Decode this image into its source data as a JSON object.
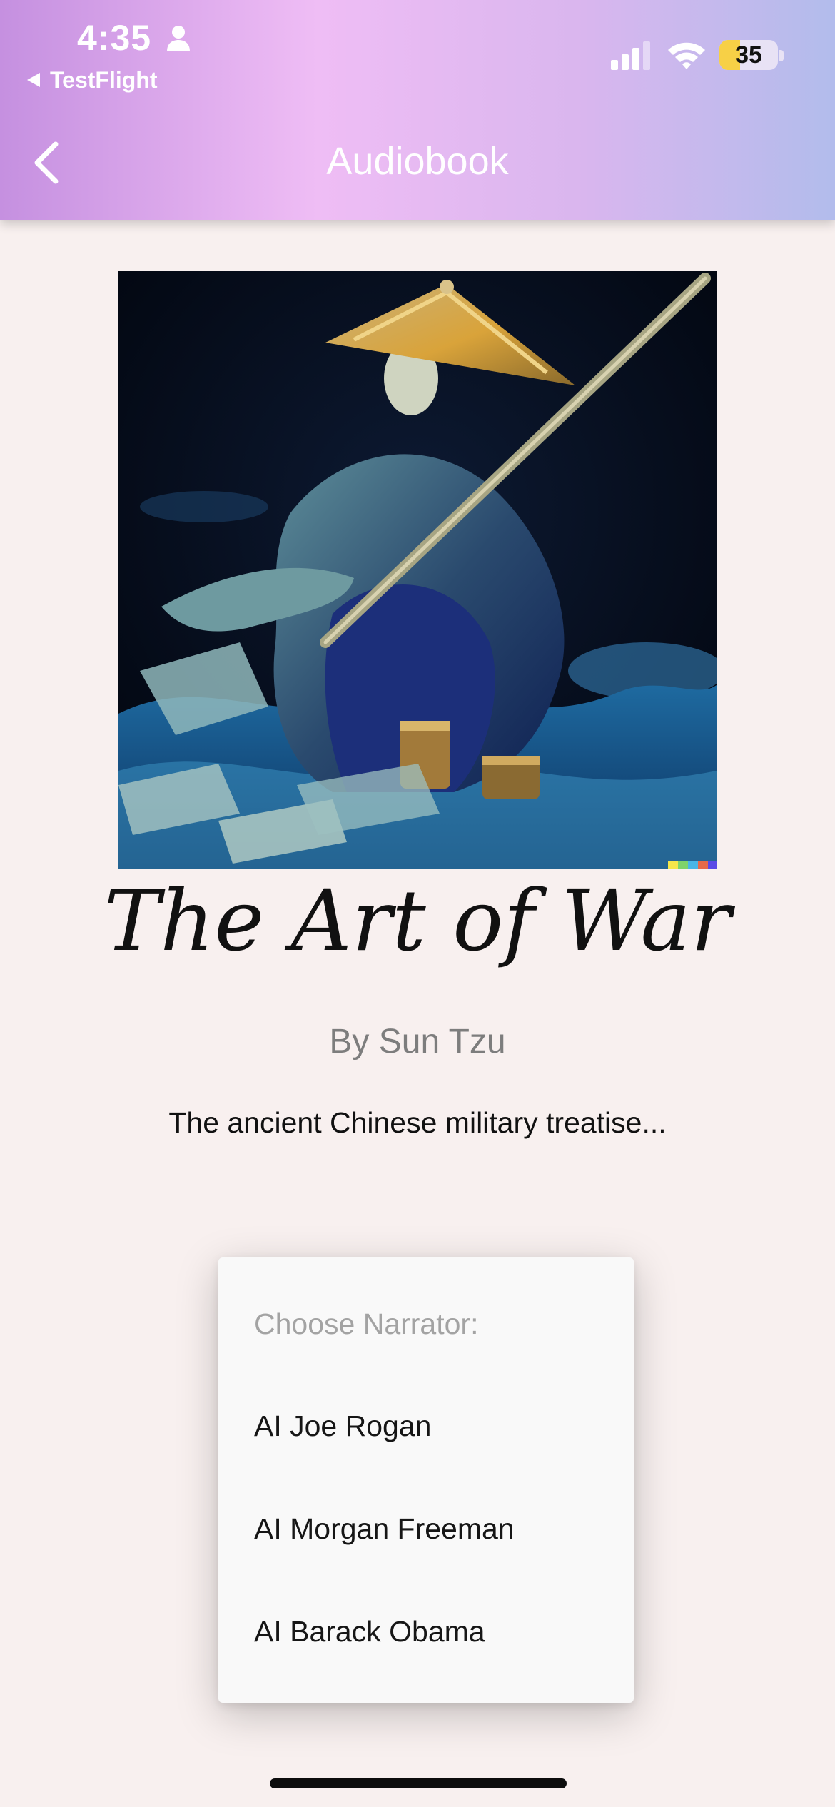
{
  "status_bar": {
    "time": "4:35",
    "back_app_label": "TestFlight",
    "battery_percent": "35",
    "battery_level": 0.35
  },
  "nav": {
    "title": "Audiobook"
  },
  "book": {
    "title": "The Art of War",
    "author": "By Sun Tzu",
    "description": "The ancient Chinese military treatise..."
  },
  "narrator_menu": {
    "heading": "Choose Narrator:",
    "options": [
      "AI Joe Rogan",
      "AI Morgan Freeman",
      "AI Barack Obama"
    ]
  },
  "colors": {
    "header_gradient": [
      "#c590e0",
      "#efbdf5",
      "#d9b6ee",
      "#b2bcec"
    ],
    "background": "#f8f0ef",
    "battery_fill": "#f7d046"
  },
  "icons": {
    "back": "chevron-left-icon",
    "person": "person-icon",
    "signal": "cellular-signal-icon",
    "wifi": "wifi-icon"
  }
}
